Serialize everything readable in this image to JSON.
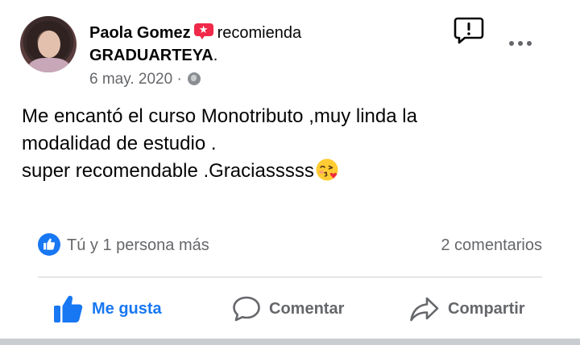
{
  "post": {
    "author": "Paola Gomez",
    "verb": "recomienda",
    "page": "GRADUARTEYA",
    "page_suffix": ".",
    "date": "6 may. 2020",
    "separator": "·",
    "privacy_icon": "globe-icon",
    "text_lines": [
      "Me encantó el curso Monotributo ,muy linda la",
      "modalidad de estudio .",
      "super recomendable .Graciasssss"
    ],
    "text_emoji": "face-blowing-kiss-emoji"
  },
  "engagement": {
    "reactions_text": "Tú y 1 persona más",
    "comments_count": "2 comentarios"
  },
  "actions": [
    {
      "label": "Me gusta",
      "icon": "thumbs-up-icon",
      "active": true
    },
    {
      "label": "Comentar",
      "icon": "comment-icon",
      "active": false
    },
    {
      "label": "Compartir",
      "icon": "share-icon",
      "active": false
    }
  ],
  "header_icons": [
    "report-icon",
    "more-options-icon"
  ],
  "colors": {
    "accent": "#1877f2",
    "recommend_badge": "#f02849",
    "secondary_text": "#65676b",
    "primary_text": "#050505"
  }
}
